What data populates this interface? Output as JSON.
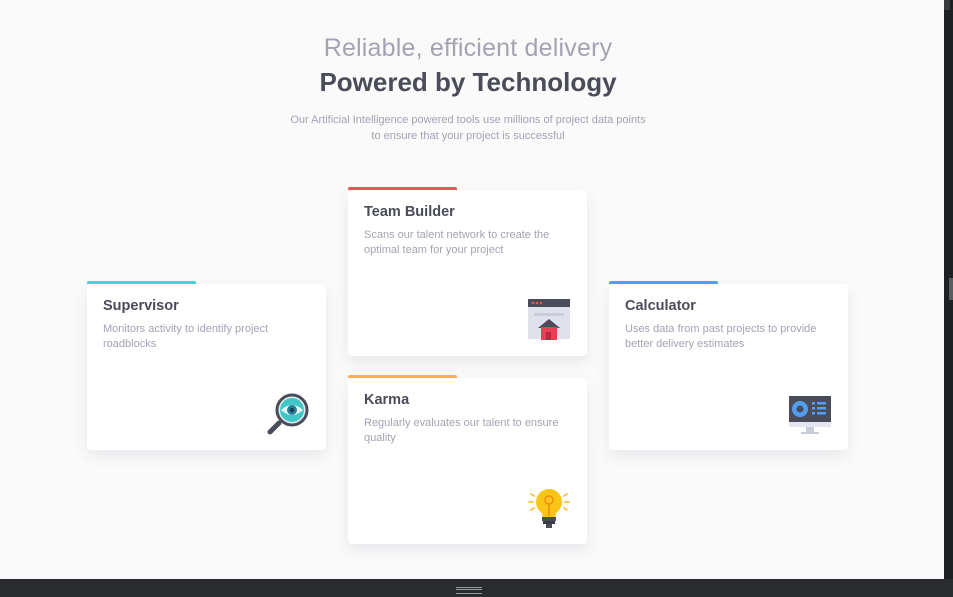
{
  "header": {
    "subtitle": "Reliable, efficient delivery",
    "title": "Powered by Technology",
    "intro": "Our Artificial Intelligence powered tools use millions of project data points to ensure that your project is successful"
  },
  "cards": [
    {
      "title": "Supervisor",
      "description": "Monitors activity to identify project roadblocks",
      "icon": "magnifier-icon",
      "accent": "#44d3d2"
    },
    {
      "title": "Team Builder",
      "description": "Scans our talent network to create the optimal team for your project",
      "icon": "team-builder-icon",
      "accent": "#ea5454"
    },
    {
      "title": "Karma",
      "description": "Regularly evaluates our talent to ensure quality",
      "icon": "lightbulb-icon",
      "accent": "#fcaf4a"
    },
    {
      "title": "Calculator",
      "description": "Uses data from past projects to provide better delivery estimates",
      "icon": "calculator-icon",
      "accent": "#549ef2"
    }
  ]
}
